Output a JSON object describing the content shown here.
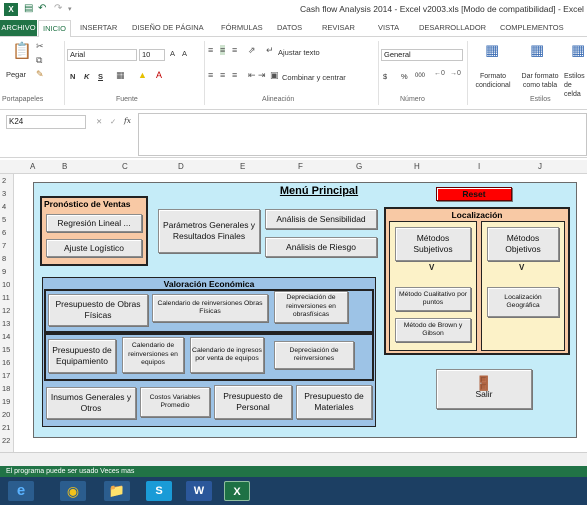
{
  "window": {
    "title": "Cash flow Analysis 2014 - Excel v2003.xls  [Modo de compatibilidad] - Excel"
  },
  "tabs": [
    "ARCHIVO",
    "INICIO",
    "INSERTAR",
    "DISEÑO DE PÁGINA",
    "FÓRMULAS",
    "DATOS",
    "REVISAR",
    "VISTA",
    "DESARROLLADOR",
    "COMPLEMENTOS"
  ],
  "ribbon": {
    "paste": "Pegar",
    "font_name": "Arial",
    "font_size": "10",
    "bold": "N",
    "italic": "K",
    "underline": "S",
    "wrap_text": "Ajustar texto",
    "merge_center": "Combinar y centrar",
    "number_format": "General",
    "currency": "$",
    "percent": "%",
    "thousands": "000",
    "cond_format": "Formato condicional",
    "table_format": "Dar formato como tabla",
    "cell_styles": "Estilos de celda",
    "groups": {
      "clipboard": "Portapapeles",
      "font": "Fuente",
      "alignment": "Alineación",
      "number": "Número",
      "styles": "Estilos"
    }
  },
  "formula_bar": {
    "name_box": "K24",
    "fx": "fx",
    "value": ""
  },
  "columns": [
    "A",
    "B",
    "C",
    "D",
    "E",
    "F",
    "G",
    "H",
    "I",
    "J"
  ],
  "rows": [
    "2",
    "3",
    "4",
    "5",
    "6",
    "7",
    "8",
    "9",
    "10",
    "11",
    "12",
    "13",
    "14",
    "15",
    "16",
    "17",
    "18",
    "19",
    "20",
    "21",
    "22"
  ],
  "menu": {
    "title": "Menú Principal",
    "reset": "Reset",
    "ventas": {
      "header": "Pronóstico de Ventas",
      "regresion": "Regresión Lineal ...",
      "ajuste": "Ajuste Logístico"
    },
    "parametros": "Parámetros Generales y Resultados Finales",
    "sensibilidad": "Análisis de Sensibilidad",
    "riesgo": "Análisis de Riesgo",
    "localizacion": {
      "header": "Localización",
      "subjetivos": "Métodos Subjetivos",
      "objetivos": "Métodos Objetivos",
      "cualitativo": "Método Cualitativo por puntos",
      "brown": "Método de Brown y Gibson",
      "geografica": "Localización Geográfica"
    },
    "valoracion": {
      "header": "Valoración Económica",
      "obras": "Presupuesto de Obras Físicas",
      "cal_obras": "Calendario de reinversiones Obras Físicas",
      "dep_obras": "Depreciación de reinversiones en obrasfísicas",
      "equipamiento": "Presupuesto de Equipamiento",
      "cal_equipos": "Calendario de reinversiones en equipos",
      "cal_ingresos": "Calendario de ingresos por venta de equipos",
      "dep_reinv": "Depreciación de reinversiones",
      "insumos": "Insumos Generales y Otros",
      "costos": "Costos Variables Promedio",
      "personal": "Presupuesto de Personal",
      "materiales": "Presupuesto de Materiales"
    },
    "salir": "Salir"
  },
  "status": "El programa puede ser usado  Veces mas"
}
